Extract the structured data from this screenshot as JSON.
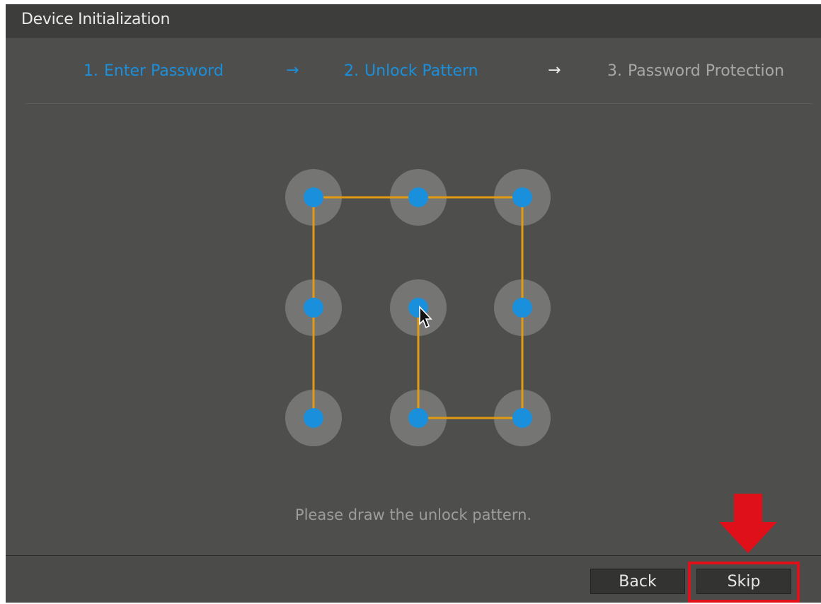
{
  "window": {
    "title": "Device Initialization"
  },
  "steps": [
    {
      "number": "1.",
      "label": "Enter Password",
      "state": "active"
    },
    {
      "number": "2.",
      "label": "Unlock Pattern",
      "state": "active"
    },
    {
      "number": "3.",
      "label": "Password Protection",
      "state": "inactive"
    }
  ],
  "step_arrows": [
    "→",
    "→"
  ],
  "pattern": {
    "grid": "3x3",
    "drawn_sequence": [
      5,
      8,
      9,
      6,
      3,
      2,
      1,
      4,
      7
    ],
    "colors": {
      "dot": "#1a8fdc",
      "halo": "#757673",
      "line": "#e29a12"
    }
  },
  "hint": "Please draw the unlock pattern.",
  "buttons": {
    "back": "Back",
    "skip": "Skip"
  },
  "annotation": {
    "color": "#e0101b",
    "target": "skip-button"
  }
}
